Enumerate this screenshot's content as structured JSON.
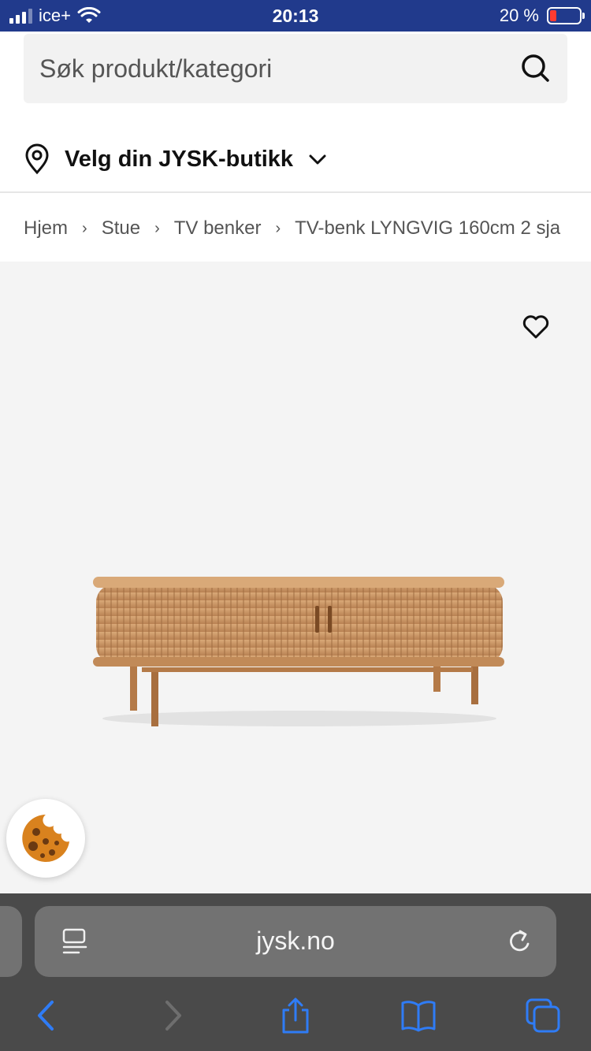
{
  "status_bar": {
    "carrier": "ice+",
    "time": "20:13",
    "battery": "20 %",
    "battery_level": 0.2
  },
  "search": {
    "placeholder": "Søk produkt/kategori",
    "icon": "search-icon"
  },
  "store_selector": {
    "label": "Velg din JYSK-butikk",
    "icon": "location-pin-icon"
  },
  "breadcrumb": {
    "items": [
      "Hjem",
      "Stue",
      "TV benker",
      "TV-benk LYNGVIG 160cm 2 sja"
    ]
  },
  "product": {
    "favorite_icon": "heart-icon",
    "cookie_icon": "cookie-icon"
  },
  "browser": {
    "url": "jysk.no",
    "reader_icon": "reader-icon",
    "reload_icon": "reload-icon",
    "toolbar": [
      "back-icon",
      "forward-icon",
      "share-icon",
      "bookmarks-icon",
      "tabs-icon"
    ]
  },
  "colors": {
    "status_bar": "#213a8c",
    "browser_bar": "#4a4a4a",
    "accent_blue": "#2f7cf6",
    "wood": "#c99463"
  }
}
